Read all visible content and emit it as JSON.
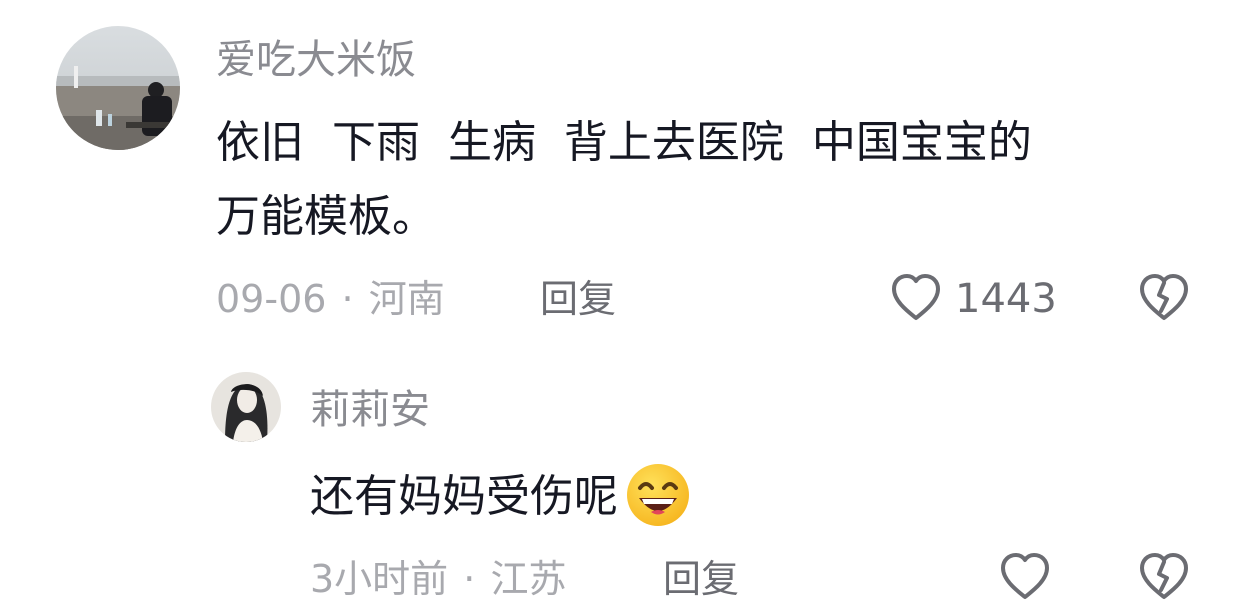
{
  "comments": [
    {
      "username": "爱吃大米饭",
      "content_line1": "依旧  下雨  生病  背上去医院  中国宝宝的",
      "content_line2": "万能模板。",
      "date": "09-06",
      "separator": "·",
      "location": "河南",
      "reply_label": "回复",
      "like_count": "1443",
      "avatar_icon": "user-avatar-photo",
      "like_icon": "heart-outline",
      "dislike_icon": "broken-heart"
    },
    {
      "username": "莉莉安",
      "content": "还有妈妈受伤呢",
      "emoji_icon": "grinning-face-emoji",
      "date": "3小时前",
      "separator": "·",
      "location": "江苏",
      "reply_label": "回复",
      "like_icon": "heart-outline",
      "dislike_icon": "broken-heart"
    }
  ]
}
